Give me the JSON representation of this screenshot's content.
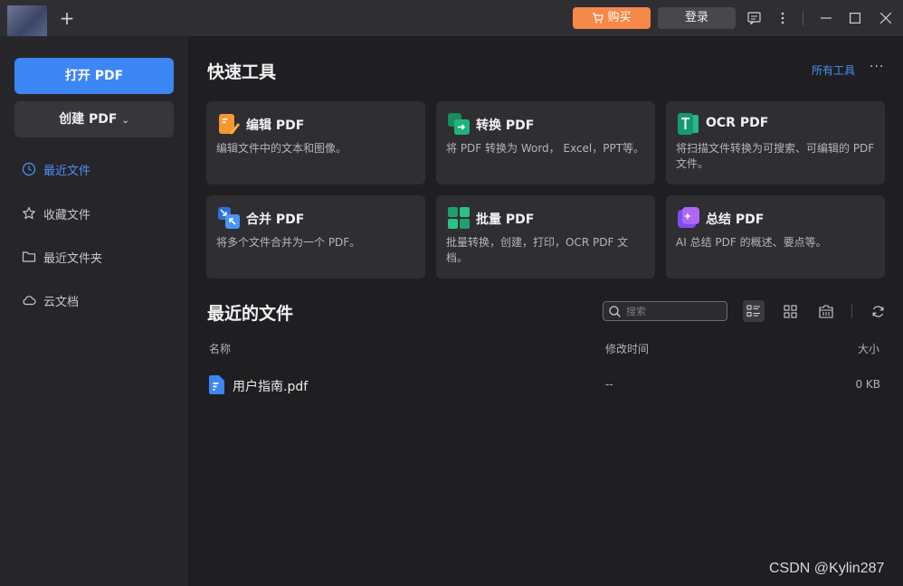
{
  "titlebar": {
    "buy_label": "购买",
    "login_label": "登录"
  },
  "sidebar": {
    "open_label": "打开 PDF",
    "create_label": "创建 PDF",
    "items": [
      {
        "label": "最近文件",
        "icon": "clock-icon",
        "active": true
      },
      {
        "label": "收藏文件",
        "icon": "star-icon",
        "active": false
      },
      {
        "label": "最近文件夹",
        "icon": "folder-icon",
        "active": false
      },
      {
        "label": "云文档",
        "icon": "cloud-icon",
        "active": false
      }
    ]
  },
  "tools": {
    "title": "快速工具",
    "all_tools_label": "所有工具",
    "cards": [
      {
        "name": "编辑 PDF",
        "desc": "编辑文件中的文本和图像。",
        "icon": "edit-pdf-icon"
      },
      {
        "name": "转换 PDF",
        "desc": "将 PDF 转换为 Word， Excel，PPT等。",
        "icon": "convert-pdf-icon"
      },
      {
        "name": "OCR PDF",
        "desc": "将扫描文件转换为可搜索、可编辑的 PDF 文件。",
        "icon": "ocr-pdf-icon"
      },
      {
        "name": "合并 PDF",
        "desc": "将多个文件合并为一个 PDF。",
        "icon": "merge-pdf-icon"
      },
      {
        "name": "批量 PDF",
        "desc": "批量转换，创建，打印，OCR PDF 文档。",
        "icon": "batch-pdf-icon"
      },
      {
        "name": "总结 PDF",
        "desc": "AI 总结 PDF 的概述、要点等。",
        "icon": "summarize-pdf-icon"
      }
    ]
  },
  "recent": {
    "title": "最近的文件",
    "search_placeholder": "搜索",
    "columns": {
      "name": "名称",
      "modified": "修改时间",
      "size": "大小"
    },
    "files": [
      {
        "name": "用户指南.pdf",
        "modified": "--",
        "size": "0 KB"
      }
    ]
  },
  "watermark": "CSDN @Kylin287",
  "colors": {
    "accent": "#3c86f5",
    "buy": "#f6884a",
    "background": "#1f1f22",
    "sidebar": "#26262a",
    "card": "#2e2e33"
  }
}
